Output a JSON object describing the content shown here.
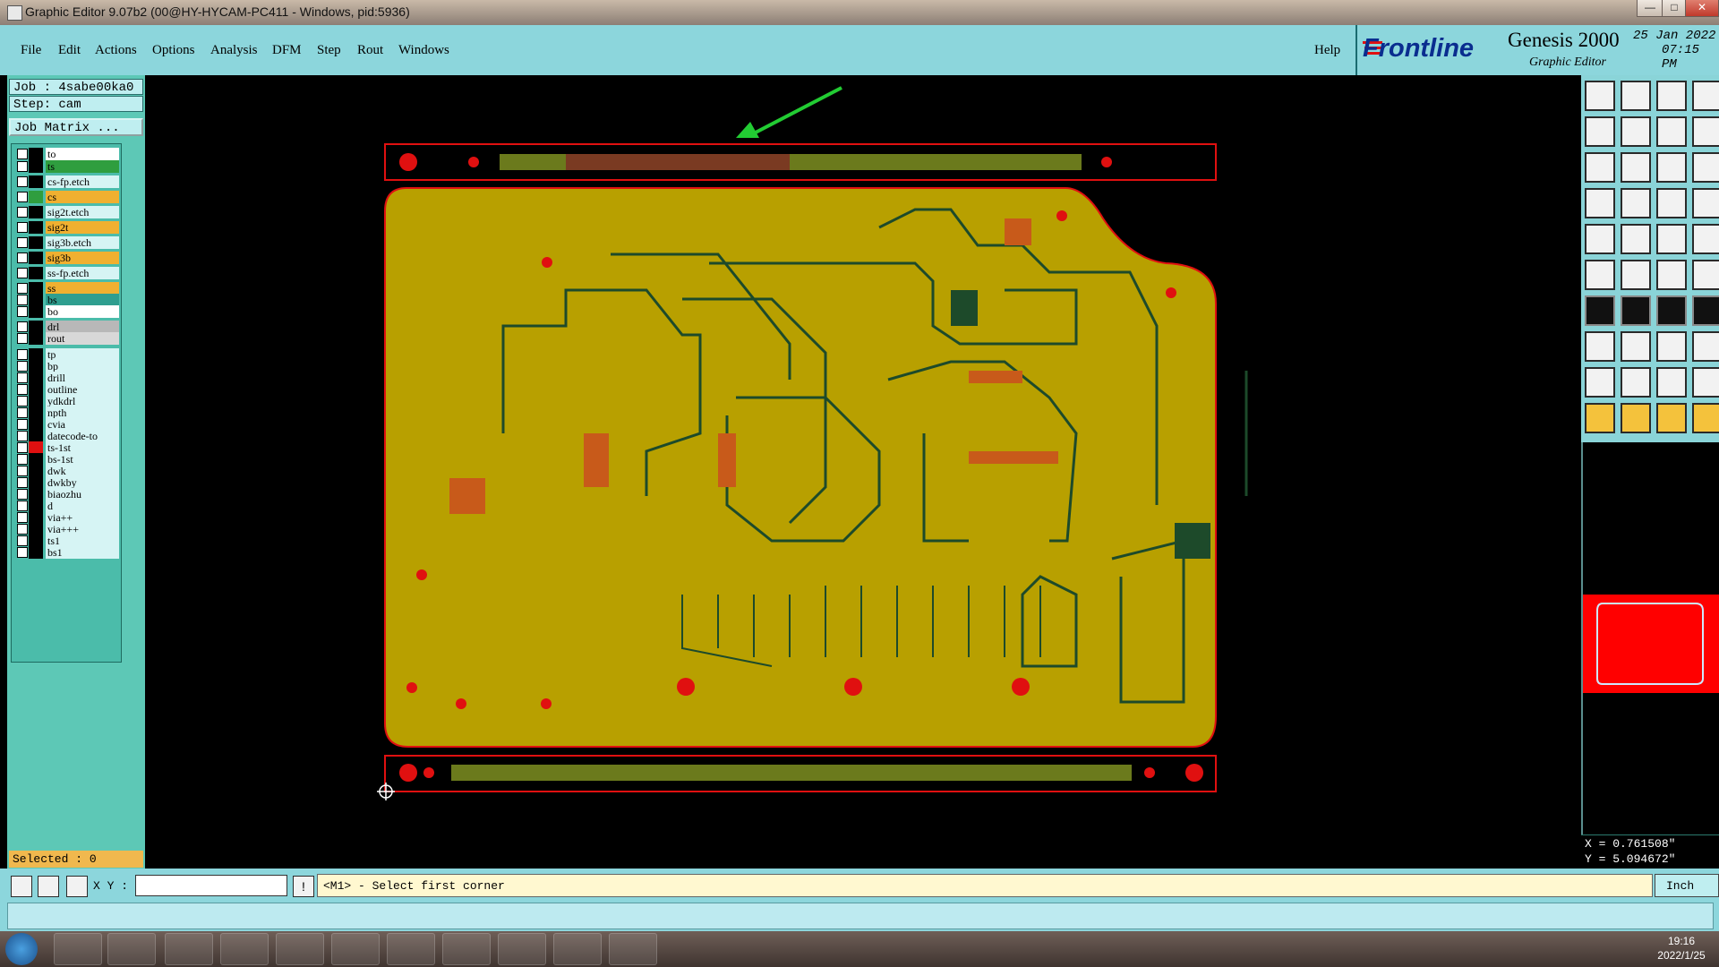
{
  "window": {
    "title": "Graphic Editor 9.07b2 (00@HY-HYCAM-PC411 - Windows, pid:5936)",
    "controls": [
      "—",
      "□",
      "✕"
    ]
  },
  "menu": {
    "items": [
      "File",
      "Edit",
      "Actions",
      "Options",
      "Analysis",
      "DFM",
      "Step",
      "Rout",
      "Windows"
    ],
    "help": "Help"
  },
  "brand": {
    "logo": "Frontline",
    "product": "Genesis 2000",
    "subtitle": "Graphic Editor",
    "date": "25 Jan 2022",
    "time": "07:15 PM"
  },
  "job": {
    "job_label": "Job : 4sabe00ka0",
    "step_label": "Step: cam",
    "matrix_button": "Job Matrix ..."
  },
  "layers": [
    {
      "name": "to",
      "color": "#ffffff",
      "swatch": "#000000"
    },
    {
      "name": "ts",
      "color": "#2f9e3f",
      "swatch": "#000000"
    },
    {
      "name": "cs-fp.etch",
      "color": "#d6f4f4",
      "swatch": "#000000"
    },
    {
      "name": "cs",
      "color": "#f0b030",
      "swatch": "#2f9e3f"
    },
    {
      "name": "sig2t.etch",
      "color": "#d6f4f4",
      "swatch": "#000000"
    },
    {
      "name": "sig2t",
      "color": "#f0b030",
      "swatch": "#000000"
    },
    {
      "name": "sig3b.etch",
      "color": "#d6f4f4",
      "swatch": "#000000"
    },
    {
      "name": "sig3b",
      "color": "#f0b030",
      "swatch": "#000000"
    },
    {
      "name": "ss-fp.etch",
      "color": "#d6f4f4",
      "swatch": "#000000"
    },
    {
      "name": "ss",
      "color": "#f0b030",
      "swatch": "#000000"
    },
    {
      "name": "bs",
      "color": "#2f9e8f",
      "swatch": "#000000"
    },
    {
      "name": "bo",
      "color": "#ffffff",
      "swatch": "#000000"
    },
    {
      "name": "drl",
      "color": "#b8b8b8",
      "swatch": "#000000"
    },
    {
      "name": "rout",
      "color": "#d8d8d8",
      "swatch": "#000000"
    },
    {
      "name": "tp",
      "color": "#d6f4f4",
      "swatch": "#000000"
    },
    {
      "name": "bp",
      "color": "#d6f4f4",
      "swatch": "#000000"
    },
    {
      "name": "drill",
      "color": "#d6f4f4",
      "swatch": "#000000"
    },
    {
      "name": "outline",
      "color": "#d6f4f4",
      "swatch": "#000000"
    },
    {
      "name": "ydkdrl",
      "color": "#d6f4f4",
      "swatch": "#000000"
    },
    {
      "name": "npth",
      "color": "#d6f4f4",
      "swatch": "#000000"
    },
    {
      "name": "cvia",
      "color": "#d6f4f4",
      "swatch": "#000000"
    },
    {
      "name": "datecode-to",
      "color": "#d6f4f4",
      "swatch": "#000000"
    },
    {
      "name": "ts-1st",
      "color": "#d6f4f4",
      "swatch": "#e01010"
    },
    {
      "name": "bs-1st",
      "color": "#d6f4f4",
      "swatch": "#000000"
    },
    {
      "name": "dwk",
      "color": "#d6f4f4",
      "swatch": "#000000"
    },
    {
      "name": "dwkby",
      "color": "#d6f4f4",
      "swatch": "#000000"
    },
    {
      "name": "biaozhu",
      "color": "#d6f4f4",
      "swatch": "#000000"
    },
    {
      "name": "d",
      "color": "#d6f4f4",
      "swatch": "#000000"
    },
    {
      "name": "via++",
      "color": "#d6f4f4",
      "swatch": "#000000"
    },
    {
      "name": "via+++",
      "color": "#d6f4f4",
      "swatch": "#000000"
    },
    {
      "name": "ts1",
      "color": "#d6f4f4",
      "swatch": "#000000"
    },
    {
      "name": "bs1",
      "color": "#d6f4f4",
      "swatch": "#000000"
    }
  ],
  "selection": {
    "label": "Selected : 0"
  },
  "cursor": {
    "x": "X = 0.761508\"",
    "y": "Y = 5.094672\""
  },
  "bottom": {
    "xy_label": "X Y :",
    "xy_value": "",
    "prompt": "<M1> - Select first corner",
    "units": "Inch"
  },
  "taskbar": {
    "time": "19:16",
    "date": "2022/1/25"
  },
  "colors": {
    "board": "#b8a000",
    "trace": "#1d4a2a",
    "outline": "#e01010",
    "menu_bg": "#8cd6dc",
    "panel_bg": "#5dc8b6"
  }
}
